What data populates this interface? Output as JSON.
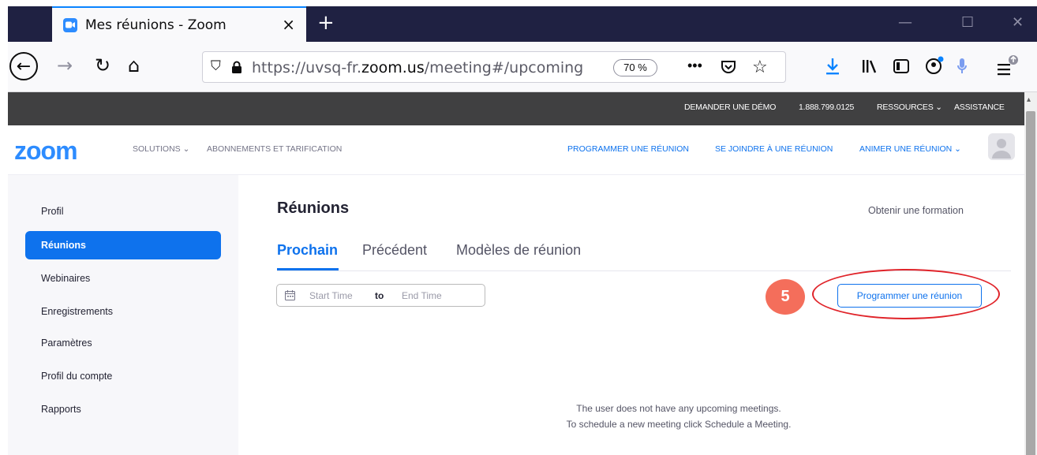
{
  "browser": {
    "tab_title": "Mes réunions - Zoom",
    "tab_close": "×",
    "new_tab": "+",
    "url_prefix": "https://uvsq-fr.",
    "url_domain": "zoom.us",
    "url_suffix": "/meeting#/upcoming",
    "zoom_level": "70 %",
    "icons": [
      "back-icon",
      "forward-icon",
      "reload-icon",
      "home-icon",
      "shield-icon",
      "lock-icon",
      "more-icon",
      "pocket-icon",
      "star-icon",
      "download-icon",
      "library-icon",
      "sidebar-icon",
      "account-icon",
      "microphone-icon",
      "menu-icon"
    ]
  },
  "topbar": {
    "demo": "DEMANDER UNE DÉMO",
    "phone": "1.888.799.0125",
    "resources": "RESSOURCES ⌄",
    "support": "ASSISTANCE"
  },
  "header": {
    "logo": "zoom",
    "solutions": "SOLUTIONS ⌄",
    "pricing": "ABONNEMENTS ET TARIFICATION",
    "schedule": "PROGRAMMER UNE RÉUNION",
    "join": "SE JOINDRE À UNE RÉUNION",
    "host": "ANIMER UNE RÉUNION ⌄"
  },
  "sidebar": {
    "items": [
      {
        "label": "Profil",
        "active": false
      },
      {
        "label": "Réunions",
        "active": true
      },
      {
        "label": "Webinaires",
        "active": false
      },
      {
        "label": "Enregistrements",
        "active": false
      },
      {
        "label": "Paramètres",
        "active": false
      },
      {
        "label": "Profil du compte",
        "active": false
      },
      {
        "label": "Rapports",
        "active": false
      }
    ]
  },
  "main": {
    "title": "Réunions",
    "training_link": "Obtenir une formation",
    "tabs": [
      {
        "label": "Prochain",
        "active": true
      },
      {
        "label": "Précédent",
        "active": false
      },
      {
        "label": "Modèles de réunion",
        "active": false
      }
    ],
    "date_start_placeholder": "Start Time",
    "date_to": "to",
    "date_end_placeholder": "End Time",
    "schedule_button": "Programmer une réunion",
    "step_badge": "5",
    "empty_line1": "The user does not have any upcoming meetings.",
    "empty_line2": "To schedule a new meeting click Schedule a Meeting."
  },
  "colors": {
    "zoom_blue": "#0e72ed",
    "badge": "#f46e5b",
    "highlight": "#e0242a"
  }
}
